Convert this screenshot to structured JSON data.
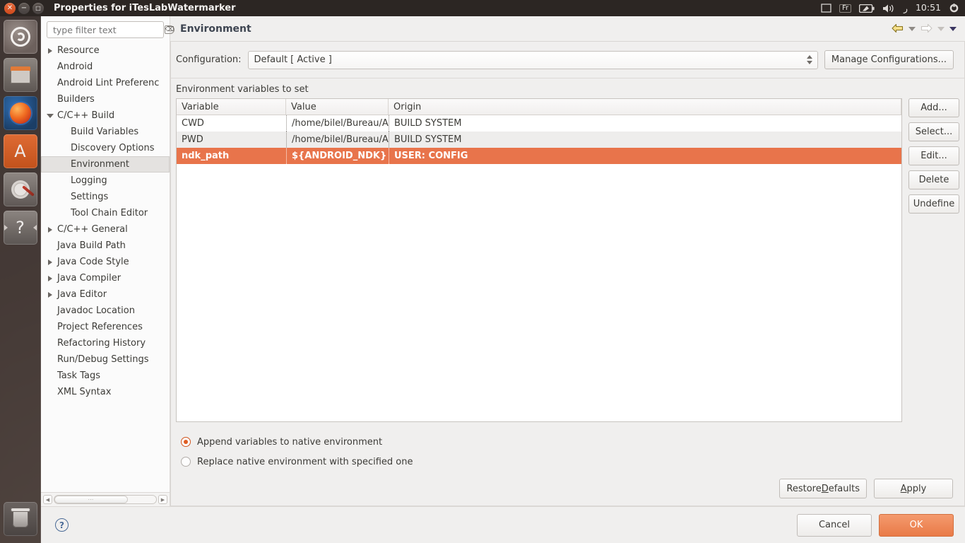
{
  "window": {
    "title": "Properties for iTesLabWatermarker",
    "controls": [
      {
        "name": "close",
        "glyph": "✕"
      },
      {
        "name": "minimize",
        "glyph": "−"
      },
      {
        "name": "maximize",
        "glyph": "□"
      }
    ]
  },
  "tray": {
    "keyboard_layout": "Fr",
    "battery_icon": "battery-icon",
    "volume_icon": "volume-icon",
    "bluetooth_icon": "ر",
    "clock": "10:51",
    "session_icon": "gear-icon"
  },
  "launcher": {
    "items": [
      {
        "name": "ubuntu-dash",
        "label": "Dash home"
      },
      {
        "name": "files",
        "label": "Files"
      },
      {
        "name": "firefox",
        "label": "Firefox Web Browser"
      },
      {
        "name": "software-center",
        "label": "Ubuntu Software Center"
      },
      {
        "name": "system-settings",
        "label": "System Settings"
      },
      {
        "name": "help",
        "label": "Ubuntu Help"
      }
    ],
    "trash": {
      "name": "trash",
      "label": "Trash"
    }
  },
  "filter": {
    "placeholder": "type filter text",
    "value": "",
    "clear_icon": "⌫"
  },
  "tree": {
    "items": [
      {
        "label": "Resource",
        "twisty": "collapsed",
        "indent": 0,
        "selected": false
      },
      {
        "label": "Android",
        "twisty": "none",
        "indent": 0,
        "selected": false
      },
      {
        "label": "Android Lint Preferenc",
        "twisty": "none",
        "indent": 0,
        "selected": false
      },
      {
        "label": "Builders",
        "twisty": "none",
        "indent": 0,
        "selected": false
      },
      {
        "label": "C/C++ Build",
        "twisty": "expanded",
        "indent": 0,
        "selected": false
      },
      {
        "label": "Build Variables",
        "twisty": "none",
        "indent": 1,
        "selected": false
      },
      {
        "label": "Discovery Options",
        "twisty": "none",
        "indent": 1,
        "selected": false
      },
      {
        "label": "Environment",
        "twisty": "none",
        "indent": 1,
        "selected": true
      },
      {
        "label": "Logging",
        "twisty": "none",
        "indent": 1,
        "selected": false
      },
      {
        "label": "Settings",
        "twisty": "none",
        "indent": 1,
        "selected": false
      },
      {
        "label": "Tool Chain Editor",
        "twisty": "none",
        "indent": 1,
        "selected": false
      },
      {
        "label": "C/C++ General",
        "twisty": "collapsed",
        "indent": 0,
        "selected": false
      },
      {
        "label": "Java Build Path",
        "twisty": "none",
        "indent": 0,
        "selected": false
      },
      {
        "label": "Java Code Style",
        "twisty": "collapsed",
        "indent": 0,
        "selected": false
      },
      {
        "label": "Java Compiler",
        "twisty": "collapsed",
        "indent": 0,
        "selected": false
      },
      {
        "label": "Java Editor",
        "twisty": "collapsed",
        "indent": 0,
        "selected": false
      },
      {
        "label": "Javadoc Location",
        "twisty": "none",
        "indent": 0,
        "selected": false
      },
      {
        "label": "Project References",
        "twisty": "none",
        "indent": 0,
        "selected": false
      },
      {
        "label": "Refactoring History",
        "twisty": "none",
        "indent": 0,
        "selected": false
      },
      {
        "label": "Run/Debug Settings",
        "twisty": "none",
        "indent": 0,
        "selected": false
      },
      {
        "label": "Task Tags",
        "twisty": "none",
        "indent": 0,
        "selected": false
      },
      {
        "label": "XML Syntax",
        "twisty": "none",
        "indent": 0,
        "selected": false
      }
    ]
  },
  "page": {
    "title": "Environment",
    "nav": {
      "back_icon": "back-arrow-icon",
      "back_menu_icon": "chevron-down-icon",
      "forward_icon": "forward-arrow-icon",
      "forward_menu_icon": "chevron-down-icon",
      "view_menu_icon": "chevron-down-icon"
    },
    "configuration": {
      "label": "Configuration:",
      "value": "Default  [ Active ]",
      "manage_button": "Manage Configurations..."
    },
    "variables": {
      "section_label": "Environment variables to set",
      "columns": [
        "Variable",
        "Value",
        "Origin"
      ],
      "rows": [
        {
          "variable": "CWD",
          "value": "/home/bilel/Bureau/A",
          "origin": "BUILD SYSTEM",
          "selected": false
        },
        {
          "variable": "PWD",
          "value": "/home/bilel/Bureau/A",
          "origin": "BUILD SYSTEM",
          "selected": false
        },
        {
          "variable": "ndk_path",
          "value": "${ANDROID_NDK}",
          "origin": "USER: CONFIG",
          "selected": true
        }
      ],
      "buttons": [
        "Add...",
        "Select...",
        "Edit...",
        "Delete",
        "Undefine"
      ]
    },
    "radios": [
      {
        "label": "Append variables to native environment",
        "selected": true
      },
      {
        "label": "Replace native environment with specified one",
        "selected": false
      }
    ],
    "restore_defaults": {
      "pre": "Restore ",
      "mnemonic": "D",
      "post": "efaults"
    },
    "apply": {
      "pre": "",
      "mnemonic": "A",
      "post": "pply"
    }
  },
  "footer": {
    "help_icon": "?",
    "cancel": "Cancel",
    "ok": "OK"
  },
  "colors": {
    "selection": "#e8744b",
    "accent": "#df5d23",
    "panel": "#f0efee",
    "titlebar": "#2c2623"
  }
}
